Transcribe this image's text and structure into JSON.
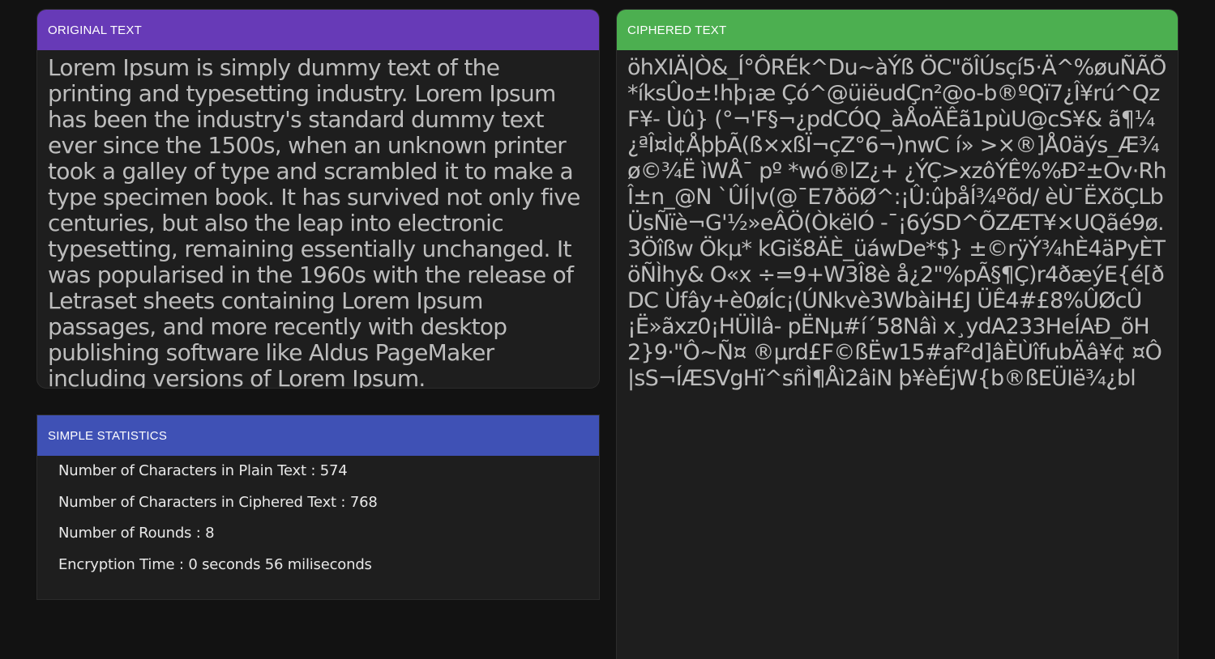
{
  "original": {
    "header": "ORIGINAL TEXT",
    "text": "Lorem Ipsum is simply dummy text of the printing and typesetting industry. Lorem Ipsum has been the industry's standard dummy text ever since the 1500s, when an unknown printer took a galley of type and scrambled it to make a type specimen book. It has survived not only five centuries, but also the leap into electronic typesetting, remaining essentially unchanged. It was popularised in the 1960s with the release of Letraset sheets containing Lorem Ipsum passages, and more recently with desktop publishing software like Aldus PageMaker including versions of Lorem Ipsum."
  },
  "cipher": {
    "header": "CIPHERED TEXT",
    "text": "öhXIÄ|Ò&_Í°ÔRÉk^Du~àÝß ÖC\"õÎÚsçí5·Ä^%øuÑÃÕ*íksÛo±!hþ¡æ Çó^@üiëudÇn²@o-b®ºQï7¿Î¥rú^QzF¥- Ùû} (°¬'F§¬¿pdCÓQ_àÅoÄÊã1pùU@cS¥& ã¶¼¿ªÎ¤Ì¢ÅþþÃ(ß×xßÏ¬çZ°6¬)nwC í» >×®]Å0äýs_Æ¾ø©¾Ë ìWÅ¯ pº *wó®lZ¿+ ¿ÝÇ>xzôÝÊ%%Ð²±Ov·RhÎ±n_@N `ÛÍ|v(@¯E7ðöØ^:¡Û:ûþåÍ¾ºõd/ èÙ¯ËXõÇLbÜsÑïè¬G'½»eÂÖ(ÒkëlÓ -¯¡6ýSD^ÕZÆT¥×UQãé9ø.3Öîßw Ökµ* kGiš8ÄÈ_üáwDe*$} ±©rÿÝ¾hÈ4äPyÈTöÑÌhy& O«x ÷=9+W3Î8è å¿2\"%pÃ§¶Ç)r4ðæýE{é[ðDC Ùfây+è0øÍc¡(ÚNkvè3WbàiH£J ÜÊ4#£8%ÛØcÛ¡Ë»ãxz0¡HÜÌlâ- pËNµ#í´58Nâì x¸ydA233HeÍAÐ_õH2}9·\"Ô~Ñ¤ ®µrd£F©ßËw15#af²d]âÈÙîfubÄâ¥¢ ¤Ô|sS¬ÍÆSVgHï^sñÌ¶Åì2âiN þ¥èÉjW{b®ßEÜIë¾¿bl"
  },
  "stats": {
    "header": "SIMPLE STATISTICS",
    "plain_chars": "Number of Characters in Plain Text : 574",
    "cipher_chars": "Number of Characters in Ciphered Text : 768",
    "rounds": "Number of Rounds : 8",
    "time": "Encryption Time : 0 seconds 56 miliseconds"
  },
  "colors": {
    "original_header": "#673ab7",
    "cipher_header": "#4caf50",
    "stats_header": "#3f51b5",
    "background": "#121212",
    "card": "#1e1e1e"
  }
}
